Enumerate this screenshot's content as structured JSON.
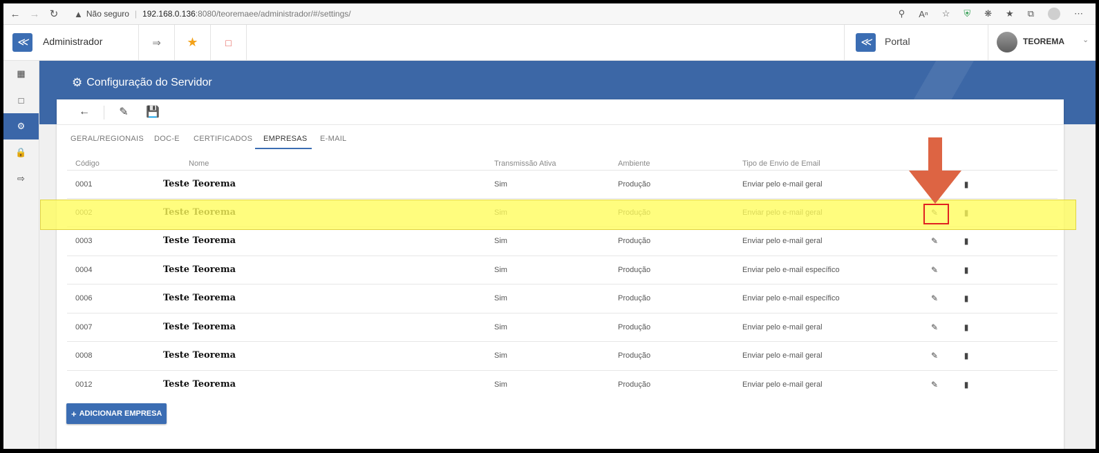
{
  "browser": {
    "security_label": "Não seguro",
    "url_host": "192.168.0.136",
    "url_rest": ":8080/teoremaee/administrador/#/settings/"
  },
  "header": {
    "app_title": "Administrador",
    "portal_label": "Portal",
    "user_name": "TEOREMA"
  },
  "page": {
    "title": "Configuração do Servidor"
  },
  "tabs": [
    {
      "label": "GERAL/REGIONAIS"
    },
    {
      "label": "DOC-E"
    },
    {
      "label": "CERTIFICADOS"
    },
    {
      "label": "EMPRESAS"
    },
    {
      "label": "E-MAIL"
    }
  ],
  "active_tab": "EMPRESAS",
  "table": {
    "columns": [
      "Código",
      "Nome",
      "Transmissão Ativa",
      "Ambiente",
      "Tipo de Envio de Email"
    ],
    "rows": [
      {
        "codigo": "0001",
        "nome": "Teste Teorema",
        "transmissao": "Sim",
        "ambiente": "Produção",
        "tipo_envio": "Enviar pelo e-mail geral"
      },
      {
        "codigo": "0002",
        "nome": "Teste Teorema",
        "transmissao": "Sim",
        "ambiente": "Produção",
        "tipo_envio": "Enviar pelo e-mail geral"
      },
      {
        "codigo": "0003",
        "nome": "Teste Teorema",
        "transmissao": "Sim",
        "ambiente": "Produção",
        "tipo_envio": "Enviar pelo e-mail geral"
      },
      {
        "codigo": "0004",
        "nome": "Teste Teorema",
        "transmissao": "Sim",
        "ambiente": "Produção",
        "tipo_envio": "Enviar pelo e-mail específico"
      },
      {
        "codigo": "0006",
        "nome": "Teste Teorema",
        "transmissao": "Sim",
        "ambiente": "Produção",
        "tipo_envio": "Enviar pelo e-mail específico"
      },
      {
        "codigo": "0007",
        "nome": "Teste Teorema",
        "transmissao": "Sim",
        "ambiente": "Produção",
        "tipo_envio": "Enviar pelo e-mail geral"
      },
      {
        "codigo": "0008",
        "nome": "Teste Teorema",
        "transmissao": "Sim",
        "ambiente": "Produção",
        "tipo_envio": "Enviar pelo e-mail geral"
      },
      {
        "codigo": "0012",
        "nome": "Teste Teorema",
        "transmissao": "Sim",
        "ambiente": "Produção",
        "tipo_envio": "Enviar pelo e-mail geral"
      }
    ]
  },
  "add_button": {
    "label": "ADICIONAR EMPRESA"
  },
  "icons": {
    "back": "arrow-left-icon",
    "edit_toolbar": "edit-square-icon",
    "save": "floppy-disk-icon",
    "row_edit": "pencil-icon",
    "row_delete": "trash-icon"
  },
  "colors": {
    "primary": "#3b6db3",
    "banner": "#3c67a6",
    "highlight": "#fff95a",
    "annotation_red": "#e02020",
    "arrow_orange": "#dd6443"
  }
}
